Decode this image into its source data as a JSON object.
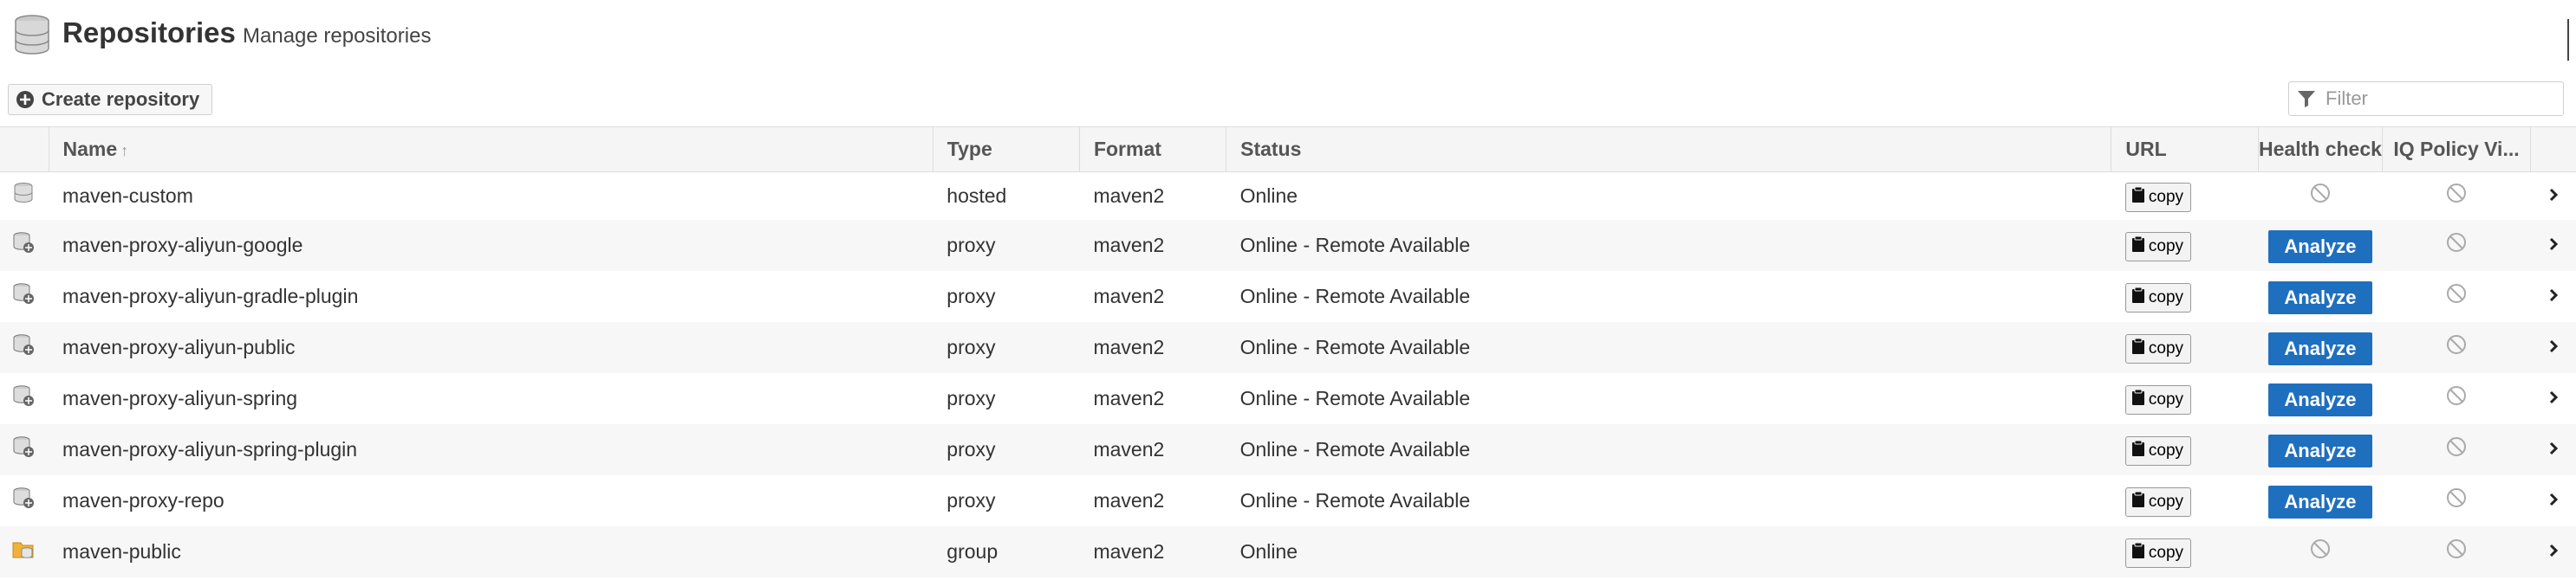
{
  "header": {
    "title": "Repositories",
    "subtitle": "Manage repositories"
  },
  "toolbar": {
    "create_label": "Create repository",
    "filter_placeholder": "Filter"
  },
  "columns": {
    "name": "Name",
    "type": "Type",
    "format": "Format",
    "status": "Status",
    "url": "URL",
    "health": "Health check",
    "iq": "IQ Policy Vi..."
  },
  "copy_label": "copy",
  "analyze_label": "Analyze",
  "rows": [
    {
      "name": "maven-custom",
      "type": "hosted",
      "format": "maven2",
      "status": "Online",
      "health": "disabled",
      "icon": "hosted-repo-icon"
    },
    {
      "name": "maven-proxy-aliyun-google",
      "type": "proxy",
      "format": "maven2",
      "status": "Online - Remote Available",
      "health": "analyze",
      "icon": "proxy-repo-icon"
    },
    {
      "name": "maven-proxy-aliyun-gradle-plugin",
      "type": "proxy",
      "format": "maven2",
      "status": "Online - Remote Available",
      "health": "analyze",
      "icon": "proxy-repo-icon"
    },
    {
      "name": "maven-proxy-aliyun-public",
      "type": "proxy",
      "format": "maven2",
      "status": "Online - Remote Available",
      "health": "analyze",
      "icon": "proxy-repo-icon"
    },
    {
      "name": "maven-proxy-aliyun-spring",
      "type": "proxy",
      "format": "maven2",
      "status": "Online - Remote Available",
      "health": "analyze",
      "icon": "proxy-repo-icon"
    },
    {
      "name": "maven-proxy-aliyun-spring-plugin",
      "type": "proxy",
      "format": "maven2",
      "status": "Online - Remote Available",
      "health": "analyze",
      "icon": "proxy-repo-icon"
    },
    {
      "name": "maven-proxy-repo",
      "type": "proxy",
      "format": "maven2",
      "status": "Online - Remote Available",
      "health": "analyze",
      "icon": "proxy-repo-icon"
    },
    {
      "name": "maven-public",
      "type": "group",
      "format": "maven2",
      "status": "Online",
      "health": "disabled",
      "icon": "group-repo-icon"
    }
  ],
  "colors": {
    "analyze": "#1f6fbf",
    "header_bg": "#f5f5f5",
    "row_alt": "#f7f7f7"
  }
}
